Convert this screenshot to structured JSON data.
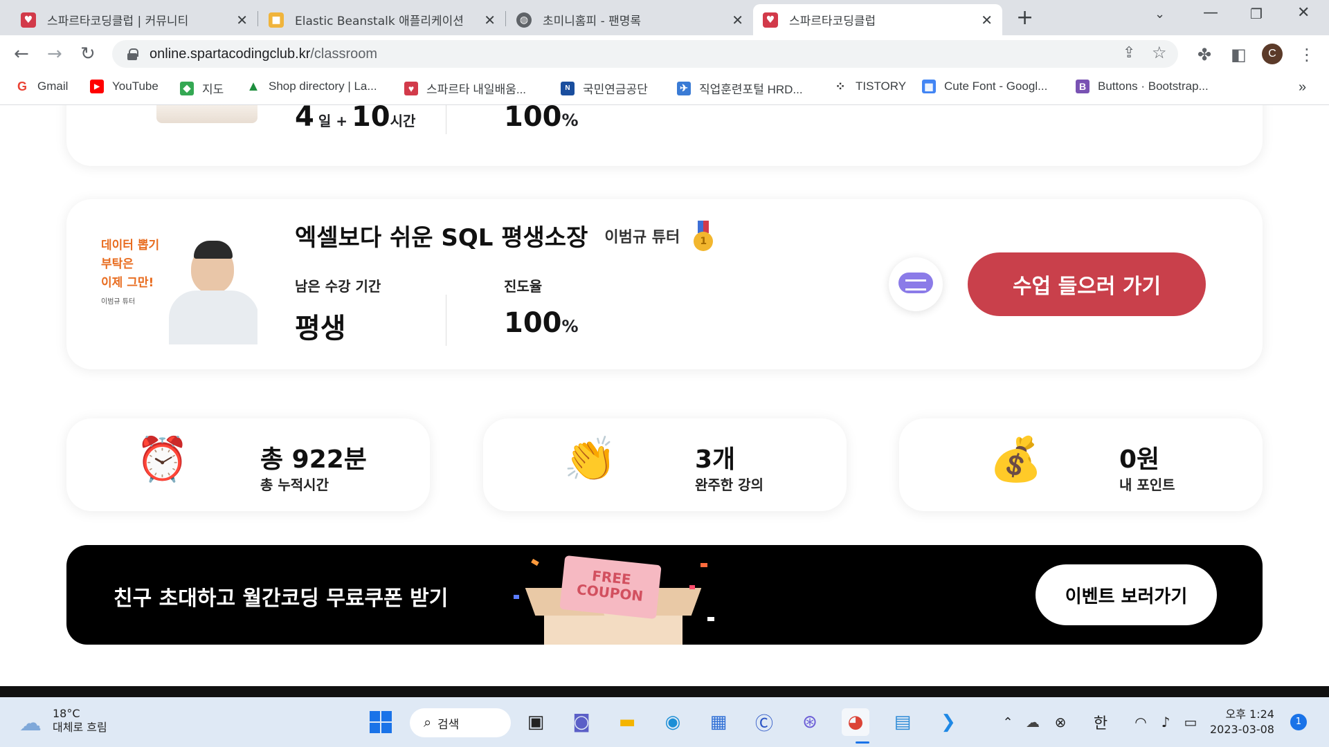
{
  "browser": {
    "tabs": [
      {
        "title": "스파르타코딩클럽 | 커뮤니티",
        "active": false
      },
      {
        "title": "Elastic Beanstalk 애플리케이션",
        "active": false
      },
      {
        "title": "초미니홈피 - 팬명록",
        "active": false
      },
      {
        "title": "스파르타코딩클럽",
        "active": true
      }
    ],
    "new_tab": "+",
    "url_host": "online.spartacodingclub.kr",
    "url_path": "/classroom",
    "profile_initial": "C",
    "bookmarks": [
      {
        "label": "Gmail",
        "icon": "G",
        "color": "#ea4335"
      },
      {
        "label": "YouTube",
        "icon": "▶",
        "color": "#ff0000"
      },
      {
        "label": "지도",
        "icon": "◆",
        "color": "#34a853"
      },
      {
        "label": "Shop directory | La...",
        "icon": "▲",
        "color": "#1e8e3e"
      },
      {
        "label": "스파르타 내일배움...",
        "icon": "♥",
        "color": "#d23a4a"
      },
      {
        "label": "국민연금공단",
        "icon": "N",
        "color": "#1a4e9e"
      },
      {
        "label": "직업훈련포털 HRD...",
        "icon": "✈",
        "color": "#3a7bd5"
      },
      {
        "label": "TISTORY",
        "icon": "⁘",
        "color": "#333333"
      },
      {
        "label": "Cute Font - Googl...",
        "icon": "▦",
        "color": "#4285f4"
      },
      {
        "label": "Buttons · Bootstrap...",
        "icon": "B",
        "color": "#7952b3"
      }
    ],
    "more_bookmarks": "»"
  },
  "course_top": {
    "days_num": "4",
    "days_unit": "일 +",
    "hours_num": "10",
    "hours_unit": "시간",
    "progress": "100",
    "percent": "%"
  },
  "course": {
    "thumb_line1": "데이터 뽑기",
    "thumb_line2": "부탁은",
    "thumb_line3": "이제 그만!",
    "thumb_tutor": "이범규 튜터",
    "title": "엑셀보다 쉬운 SQL 평생소장",
    "tutor": "이범규 튜터",
    "remaining_label": "남은 수강 기간",
    "remaining_value": "평생",
    "progress_label": "진도율",
    "progress_value": "100",
    "progress_unit": "%",
    "go_button": "수업 들으러 가기"
  },
  "stats": [
    {
      "emoji": "⏰",
      "value": "총 922분",
      "label": "총 누적시간"
    },
    {
      "emoji": "👏",
      "value": "3개",
      "label": "완주한 강의"
    },
    {
      "emoji": "💰",
      "value": "0원",
      "label": "내 포인트"
    }
  ],
  "banner": {
    "text": "친구 초대하고 월간코딩 무료쿠폰 받기",
    "coupon_line1": "FREE",
    "coupon_line2": "COUPON",
    "button": "이벤트 보러가기"
  },
  "taskbar": {
    "weather_temp": "18°C",
    "weather_desc": "대체로 흐림",
    "search": "검색",
    "ime": "한",
    "time": "오후 1:24",
    "date": "2023-03-08",
    "notif_count": "1"
  },
  "colors": {
    "accent": "#c9404b",
    "chat": "#8b7be8"
  }
}
